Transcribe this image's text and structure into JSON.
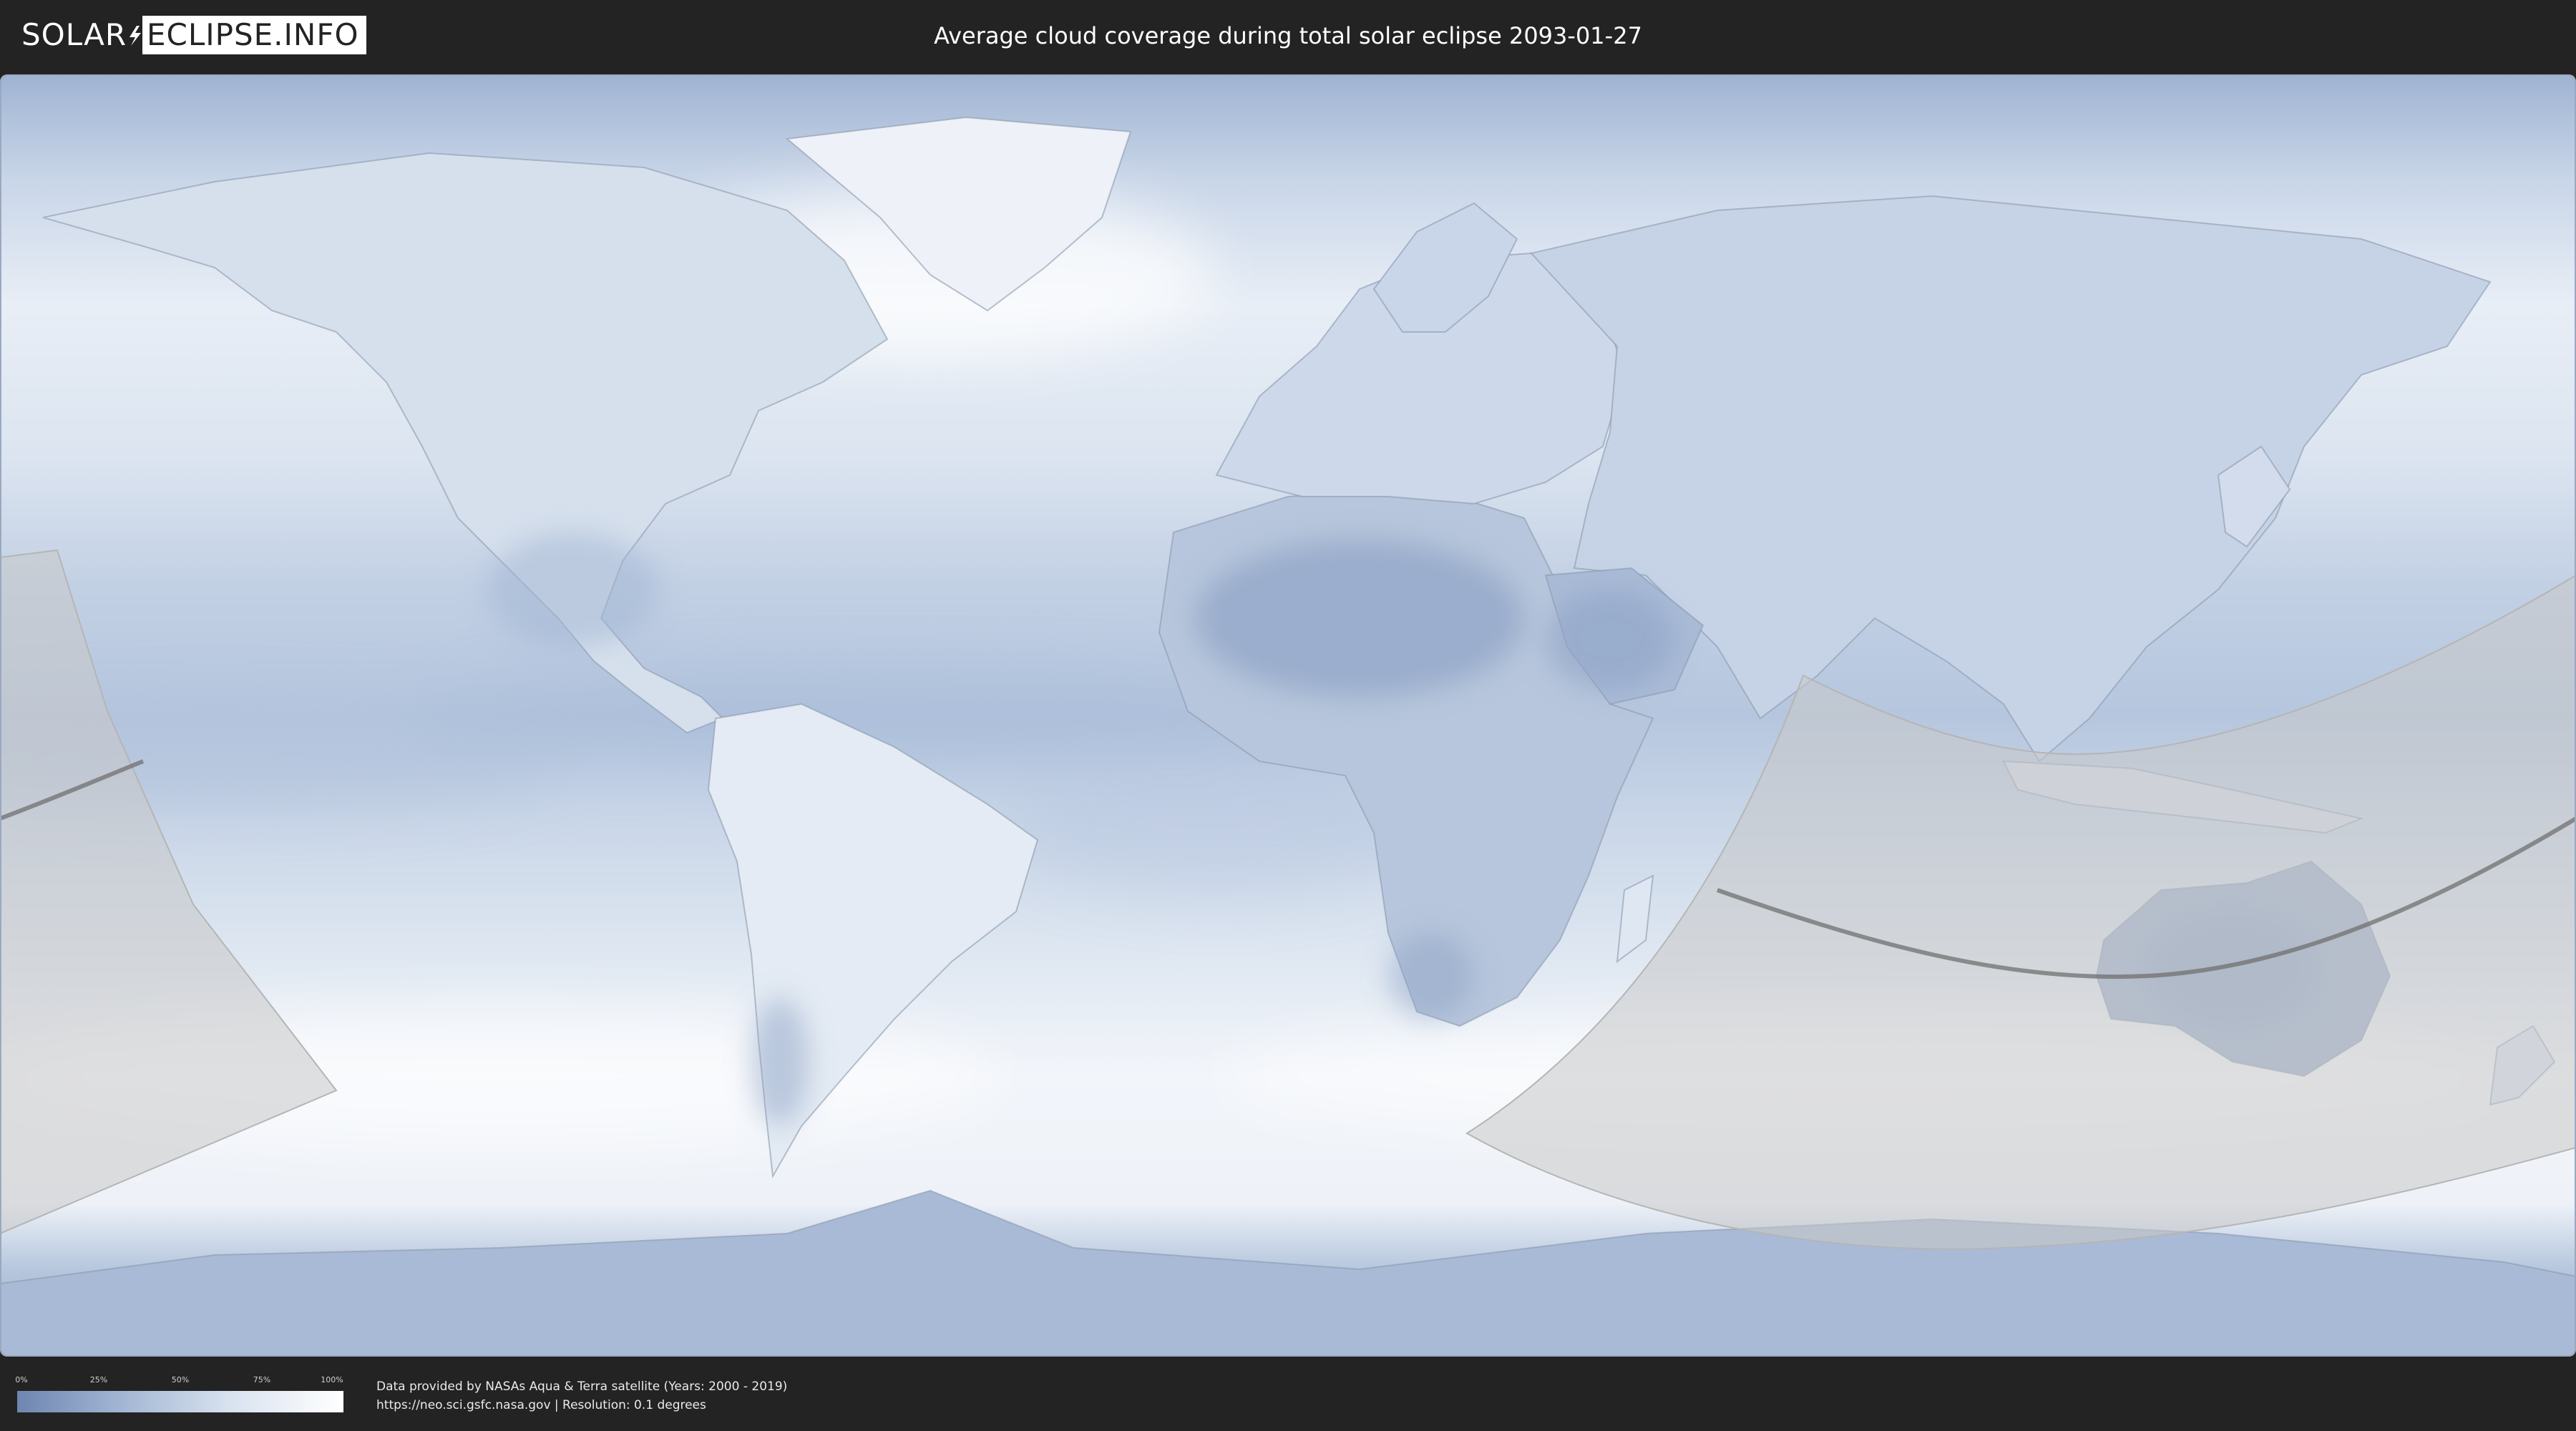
{
  "header": {
    "logo_left": "SOLAR",
    "logo_right": "ECLIPSE.INFO",
    "title": "Average cloud coverage during total solar eclipse 2093-01-27"
  },
  "legend": {
    "ticks": [
      "0%",
      "25%",
      "50%",
      "75%",
      "100%"
    ],
    "gradient_colors": [
      "#6e86b0",
      "#9fb3d2",
      "#d8e2ef",
      "#ffffff"
    ]
  },
  "credits": {
    "line1": "Data provided by NASAs Aqua & Terra satellite (Years: 2000 - 2019)",
    "line2": "https://neo.sci.gsfc.nasa.gov | Resolution: 0.1 degrees"
  },
  "colors": {
    "bar_background": "#232323",
    "ocean_cloud_base": "#c9d6e8",
    "shadow_overlay": "#c8c8c8",
    "eclipse_path": "#707070"
  }
}
